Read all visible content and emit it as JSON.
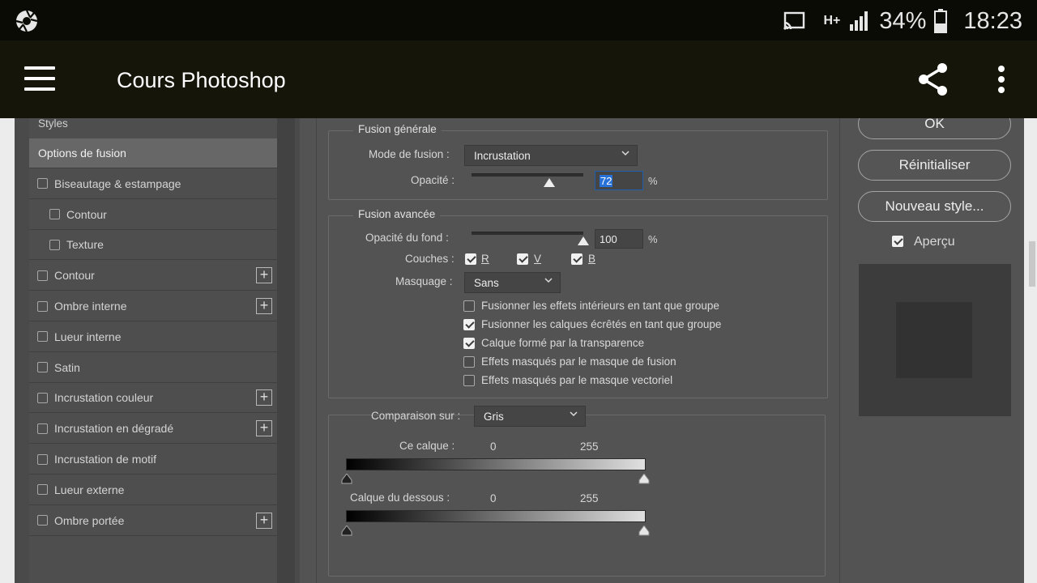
{
  "status_bar": {
    "battery": "34%",
    "time": "18:23",
    "network": "H+"
  },
  "app_bar": {
    "title": "Cours Photoshop"
  },
  "styles_list": {
    "header": "Styles",
    "items": [
      {
        "label": "Options de fusion",
        "checkbox": false,
        "selected": true,
        "plus": false,
        "indent": false
      },
      {
        "label": "Biseautage & estampage",
        "checkbox": true,
        "selected": false,
        "plus": false,
        "indent": false
      },
      {
        "label": "Contour",
        "checkbox": true,
        "selected": false,
        "plus": false,
        "indent": true
      },
      {
        "label": "Texture",
        "checkbox": true,
        "selected": false,
        "plus": false,
        "indent": true
      },
      {
        "label": "Contour",
        "checkbox": true,
        "selected": false,
        "plus": true,
        "indent": false
      },
      {
        "label": "Ombre interne",
        "checkbox": true,
        "selected": false,
        "plus": true,
        "indent": false
      },
      {
        "label": "Lueur interne",
        "checkbox": true,
        "selected": false,
        "plus": false,
        "indent": false
      },
      {
        "label": "Satin",
        "checkbox": true,
        "selected": false,
        "plus": false,
        "indent": false
      },
      {
        "label": "Incrustation couleur",
        "checkbox": true,
        "selected": false,
        "plus": true,
        "indent": false
      },
      {
        "label": "Incrustation en dégradé",
        "checkbox": true,
        "selected": false,
        "plus": true,
        "indent": false
      },
      {
        "label": "Incrustation de motif",
        "checkbox": true,
        "selected": false,
        "plus": false,
        "indent": false
      },
      {
        "label": "Lueur externe",
        "checkbox": true,
        "selected": false,
        "plus": false,
        "indent": false
      },
      {
        "label": "Ombre portée",
        "checkbox": true,
        "selected": false,
        "plus": true,
        "indent": false
      }
    ]
  },
  "general_blending": {
    "title": "Fusion générale",
    "blend_mode_label": "Mode de fusion :",
    "blend_mode_value": "Incrustation",
    "opacity_label": "Opacité :",
    "opacity_value": "72",
    "opacity_fraction": 0.72,
    "unit": "%"
  },
  "advanced_blending": {
    "title": "Fusion avancée",
    "fill_opacity_label": "Opacité du fond :",
    "fill_opacity_value": "100",
    "fill_opacity_fraction": 1.0,
    "unit": "%",
    "channels_label": "Couches :",
    "channels": [
      {
        "label": "R",
        "checked": true
      },
      {
        "label": "V",
        "checked": true
      },
      {
        "label": "B",
        "checked": true
      }
    ],
    "knockout_label": "Masquage :",
    "knockout_value": "Sans",
    "options": [
      {
        "label": "Fusionner les effets intérieurs en tant que groupe",
        "checked": false
      },
      {
        "label": "Fusionner les calques écrêtés en tant que groupe",
        "checked": true
      },
      {
        "label": "Calque formé par la transparence",
        "checked": true
      },
      {
        "label": "Effets masqués par le masque de fusion",
        "checked": false
      },
      {
        "label": "Effets masqués par le masque vectoriel",
        "checked": false
      }
    ]
  },
  "blend_if": {
    "label": "Comparaison sur :",
    "value": "Gris",
    "this_layer_label": "Ce calque :",
    "this_layer_min": "0",
    "this_layer_max": "255",
    "underlying_label": "Calque du dessous :",
    "underlying_min": "0",
    "underlying_max": "255"
  },
  "right_panel": {
    "ok_label": "OK",
    "reset_label": "Réinitialiser",
    "new_style_label": "Nouveau style...",
    "preview_label": "Aperçu",
    "preview_checked": true
  },
  "colors": {
    "status_bar_bg": "#0b0b05",
    "app_bar_bg": "#15150a",
    "dialog_bg": "#535353",
    "selection_blue": "#2871d6"
  },
  "icons": [
    "aperture-icon",
    "cast-icon",
    "signal-icon",
    "battery-icon",
    "menu-icon",
    "share-icon",
    "more-vert-icon"
  ]
}
